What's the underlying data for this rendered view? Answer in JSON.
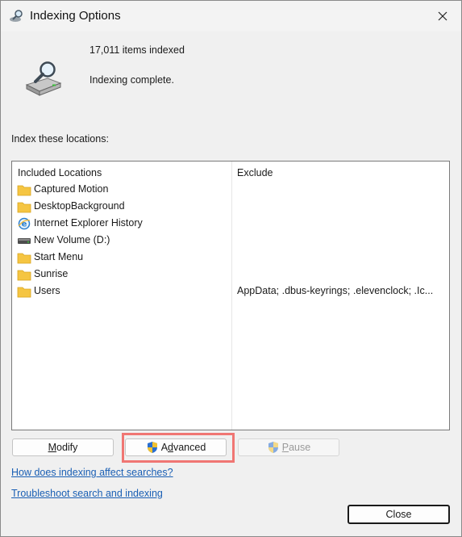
{
  "window": {
    "title": "Indexing Options"
  },
  "summary": {
    "items_indexed": "17,011 items indexed",
    "status": "Indexing complete."
  },
  "locations": {
    "label": "Index these locations:",
    "col_included": "Included Locations",
    "col_exclude": "Exclude",
    "rows": [
      {
        "name": "Captured Motion",
        "icon": "folder-icon",
        "exclude": ""
      },
      {
        "name": "DesktopBackground",
        "icon": "folder-icon",
        "exclude": ""
      },
      {
        "name": "Internet Explorer History",
        "icon": "internet-explorer-icon",
        "exclude": ""
      },
      {
        "name": "New Volume (D:)",
        "icon": "drive-icon",
        "exclude": ""
      },
      {
        "name": "Start Menu",
        "icon": "folder-icon",
        "exclude": ""
      },
      {
        "name": "Sunrise",
        "icon": "folder-icon",
        "exclude": ""
      },
      {
        "name": "Users",
        "icon": "folder-icon",
        "exclude": "AppData; .dbus-keyrings; .elevenclock; .Ic..."
      }
    ]
  },
  "buttons": {
    "modify": {
      "accel": "M",
      "rest": "odify"
    },
    "advanced": {
      "pre": "A",
      "accel": "d",
      "rest": "vanced"
    },
    "pause": {
      "accel": "P",
      "rest": "ause"
    },
    "close": "Close"
  },
  "links": {
    "help": "How does indexing affect searches?",
    "troubleshoot": "Troubleshoot search and indexing"
  },
  "colors": {
    "highlight": "#f07673",
    "link": "#1a5fb4",
    "folder": "#f5c542"
  }
}
